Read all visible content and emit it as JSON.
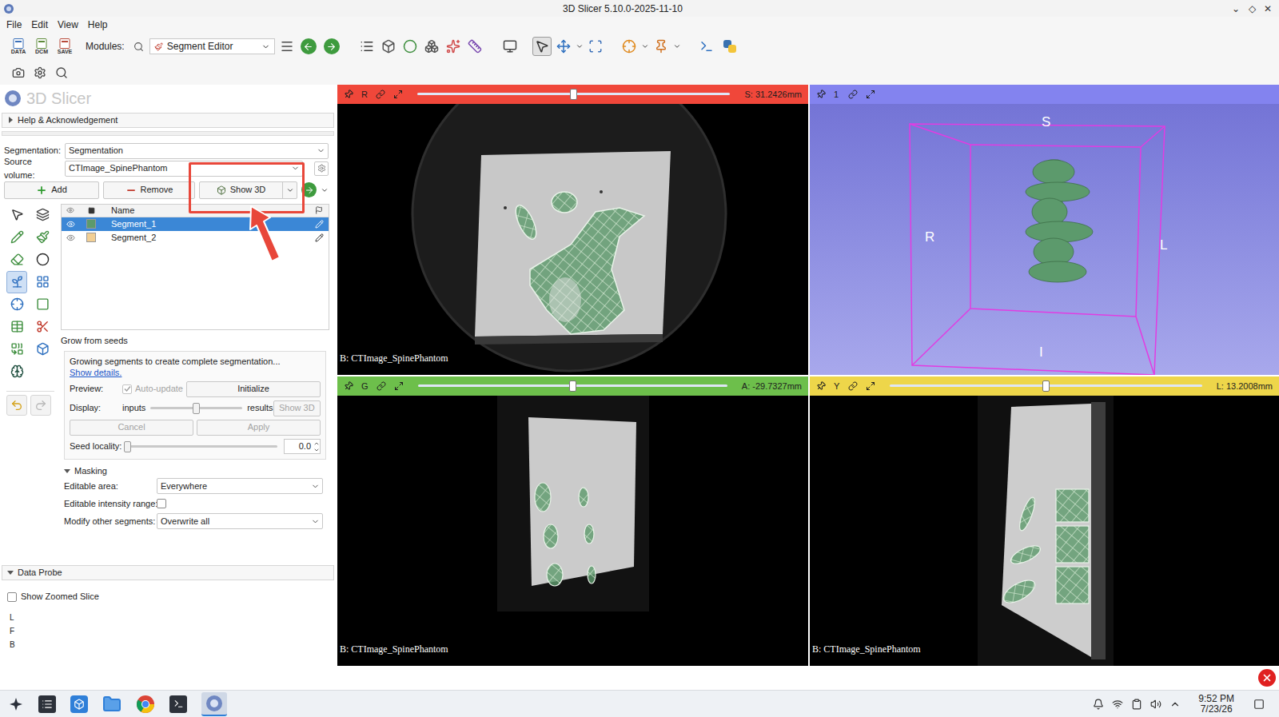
{
  "window": {
    "title": "3D Slicer 5.10.0-2025-11-10",
    "controls": [
      "⌄",
      "◇",
      "✕"
    ]
  },
  "menu": [
    "File",
    "Edit",
    "View",
    "Help"
  ],
  "toolbar": {
    "file_buttons": [
      "DATA",
      "DCM",
      "SAVE"
    ],
    "modules_label": "Modules:",
    "module": "Segment Editor",
    "mouse_modes": [
      {
        "selected": true
      },
      {
        "selected": false
      }
    ]
  },
  "panel": {
    "logo": "3D Slicer",
    "help": {
      "label": "Help & Acknowledgement",
      "expanded": false
    },
    "segmentation": {
      "label": "Segmentation:",
      "value": "Segmentation"
    },
    "source_volume": {
      "label": "Source volume:",
      "value": "CTImage_SpinePhantom"
    },
    "buttons": [
      {
        "label": "Add"
      },
      {
        "label": "Remove"
      },
      {
        "label": "Show 3D"
      }
    ],
    "table": {
      "columns": [
        "Name"
      ],
      "rows": [
        {
          "name": "Segment_1",
          "visible": true,
          "selected": true,
          "color": "#5c9a6c"
        },
        {
          "name": "Segment_2",
          "visible": true,
          "selected": false,
          "color": "#f2cf94"
        }
      ]
    },
    "effects": [
      {
        "selected": false
      },
      {
        "selected": false
      },
      {
        "selected": false
      },
      {
        "selected": false
      },
      {
        "selected": false
      },
      {
        "selected": false
      },
      {
        "selected": true
      },
      {
        "selected": false
      },
      {
        "selected": false
      },
      {
        "selected": false
      },
      {
        "selected": false
      },
      {
        "selected": false
      },
      {
        "selected": false
      },
      {
        "selected": false
      },
      {
        "selected": false
      }
    ],
    "effect": {
      "title": "Grow from seeds",
      "description": "Growing segments to create complete segmentation...",
      "link": "Show details.",
      "preview": {
        "label": "Preview:",
        "auto_update": {
          "label": "Auto-update",
          "checked": true,
          "disabled": true
        },
        "button": "Initialize"
      },
      "display": {
        "label": "Display:",
        "left": "inputs",
        "right": "results",
        "level": 0.5,
        "button": {
          "label": "Show 3D",
          "disabled": true
        }
      },
      "actions": [
        {
          "label": "Cancel",
          "disabled": true
        },
        {
          "label": "Apply",
          "disabled": true
        }
      ],
      "seed_locality": {
        "label": "Seed locality:",
        "level": 0,
        "value": "0.0"
      }
    },
    "masking": {
      "title": "Masking",
      "expanded": true,
      "editable_area": {
        "label": "Editable area:",
        "value": "Everywhere"
      },
      "intensity": {
        "label": "Editable intensity range:",
        "checked": false
      },
      "modify": {
        "label": "Modify other segments:",
        "value": "Overwrite all"
      }
    },
    "data_probe": {
      "title": "Data Probe",
      "expanded": true,
      "zoomed": {
        "label": "Show Zoomed Slice",
        "checked": false
      },
      "coords": [
        "L",
        "F",
        "B"
      ]
    }
  },
  "views": [
    {
      "name": "R",
      "kind": "axial",
      "color": "#f0473a",
      "reading": "S: 31.2426mm",
      "level": 0.5,
      "layer": "B: CTImage_SpinePhantom"
    },
    {
      "name": "G",
      "kind": "coronal",
      "color": "#6dbf4b",
      "reading": "A: -29.7327mm",
      "level": 0.5,
      "layer": "B: CTImage_SpinePhantom"
    },
    {
      "name": "Y",
      "kind": "sagittal",
      "color": "#eed64a",
      "reading": "L: 13.2008mm",
      "level": 0.5,
      "layer": "B: CTImage_SpinePhantom"
    }
  ],
  "view3d": {
    "name": "1",
    "color": "#8383ef",
    "labels": {
      "top": "S",
      "left": "R",
      "right": "L",
      "bottom": "I"
    }
  },
  "taskbar": {
    "time": "9:52 PM",
    "date": "7/23/26"
  }
}
